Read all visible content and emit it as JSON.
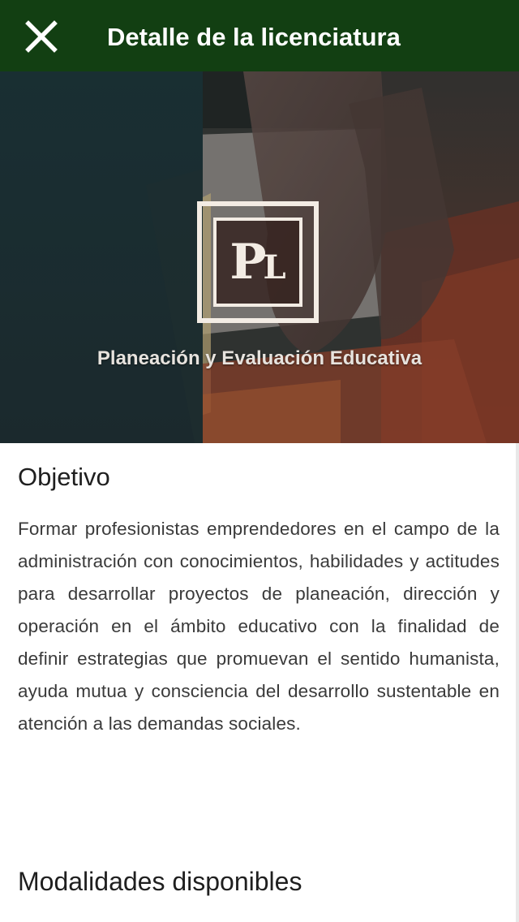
{
  "header": {
    "title": "Detalle de la licenciatura",
    "close_icon": "close-icon",
    "background": "#123f12"
  },
  "hero": {
    "logo_text_p": "P",
    "logo_text_l": "L",
    "program_name": "Planeación y Evaluación Educativa"
  },
  "objective": {
    "title": "Objetivo",
    "body": "Formar profesionistas emprendedores en el campo de la administración con conocimientos, habilidades y actitudes para desarrollar proyectos de planeación, dirección y operación en el ámbito educativo con la finalidad de definir estrategias que promuevan el sentido humanista, ayuda mutua y consciencia del desarrollo sustentable en atención a las demandas sociales."
  },
  "modalities": {
    "title": "Modalidades disponibles"
  }
}
